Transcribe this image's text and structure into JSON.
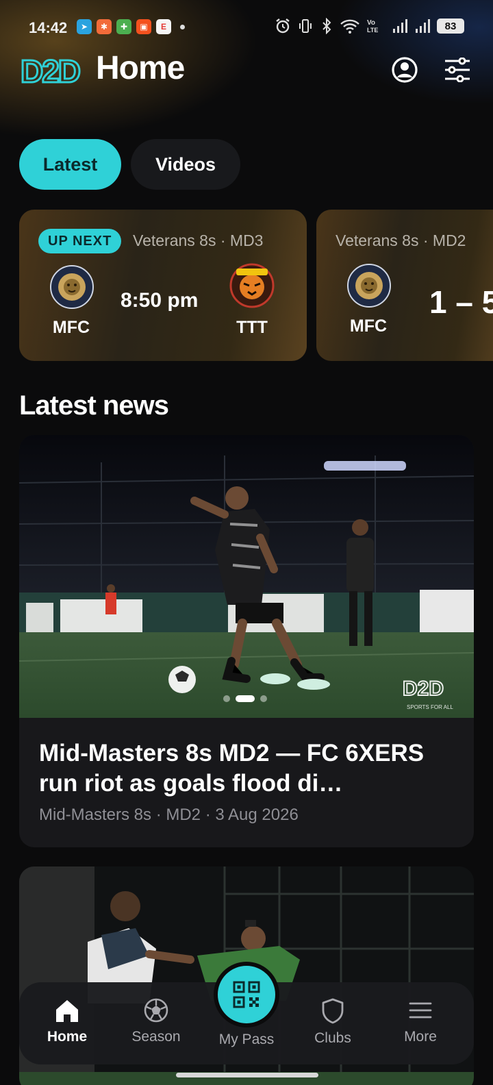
{
  "status_bar": {
    "time": "14:42",
    "battery": "83",
    "icons": [
      "telegram-icon",
      "app-orange-icon",
      "app-green-icon",
      "shop-icon",
      "app-red-icon",
      "alarm-icon",
      "vibrate-icon",
      "bluetooth-icon",
      "wifi-icon",
      "volte-icon",
      "signal-icon",
      "signal-icon"
    ]
  },
  "header": {
    "logo_text": "D2D",
    "title": "Home"
  },
  "tabs": [
    {
      "label": "Latest",
      "active": true
    },
    {
      "label": "Videos",
      "active": false
    }
  ],
  "matches": [
    {
      "badge": "UP NEXT",
      "competition": "Veterans 8s · MD3",
      "home": "MFC",
      "away": "TTT",
      "kickoff": "8:50 pm"
    },
    {
      "competition": "Veterans 8s · MD2",
      "home": "MFC",
      "score": "1 – 5"
    }
  ],
  "latest_news": {
    "section_title": "Latest news",
    "items": [
      {
        "headline": "Mid-Masters 8s MD2 — FC 6XERS run riot as goals flood di…",
        "meta": "Mid-Masters 8s · MD2 · 3 Aug 2026",
        "watermark": "D2D",
        "watermark_sub": "SPORTS FOR ALL"
      }
    ]
  },
  "bottom_nav": [
    {
      "label": "Home",
      "icon": "home-icon",
      "active": true
    },
    {
      "label": "Season",
      "icon": "football-icon",
      "active": false
    },
    {
      "label": "My Pass",
      "icon": "qr-code-icon",
      "active": false
    },
    {
      "label": "Clubs",
      "icon": "shield-icon",
      "active": false
    },
    {
      "label": "More",
      "icon": "menu-icon",
      "active": false
    }
  ],
  "colors": {
    "accent": "#2fd1d7",
    "background": "#0b0b0c",
    "card": "#18181b",
    "match_card": "#3a2c18"
  }
}
